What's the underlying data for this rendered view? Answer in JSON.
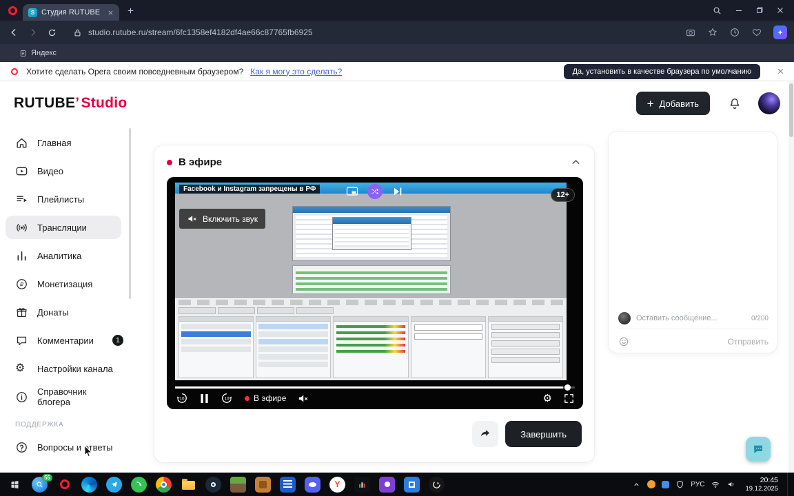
{
  "browser": {
    "tab_title": "Студия RUTUBE",
    "url": "studio.rutube.ru/stream/6fc1358ef4182df4ae66c87765fb6925",
    "bookmark": "Яндекс",
    "notification": {
      "text": "Хотите сделать Opera своим повседневным браузером?",
      "link": "Как я могу это сделать?",
      "button": "Да, установить в качестве браузера по умолчанию"
    }
  },
  "app": {
    "logo": {
      "part1": "RUTUBE",
      "part2": "Studio"
    },
    "header": {
      "add_button": "Добавить"
    },
    "sidebar": {
      "items": [
        {
          "label": "Главная"
        },
        {
          "label": "Видео"
        },
        {
          "label": "Плейлисты"
        },
        {
          "label": "Трансляции"
        },
        {
          "label": "Аналитика"
        },
        {
          "label": "Монетизация"
        },
        {
          "label": "Донаты"
        },
        {
          "label": "Комментарии",
          "badge": "1"
        },
        {
          "label": "Настройки канала"
        },
        {
          "label": "Справочник блогера"
        }
      ],
      "section_label": "ПОДДЕРЖКА",
      "support_items": [
        {
          "label": "Вопросы и ответы"
        }
      ]
    },
    "live": {
      "title": "В эфире",
      "caption": "Facebook и Instagram запрещены в РФ",
      "unmute_button": "Включить звук",
      "age_badge": "12+",
      "player_status": "В эфире",
      "finish_button": "Завершить"
    },
    "chat": {
      "placeholder": "Оставить сообщение...",
      "counter": "0/200",
      "send_button": "Отправить"
    }
  },
  "taskbar": {
    "badge": "55",
    "lang": "РУС",
    "time": "20:45",
    "date": "19.12.2025"
  },
  "colors": {
    "brand_red": "#E4003F",
    "live_red": "#FF2B3E",
    "fab_teal": "#8ED8E2",
    "dark_button": "#1D2024"
  }
}
